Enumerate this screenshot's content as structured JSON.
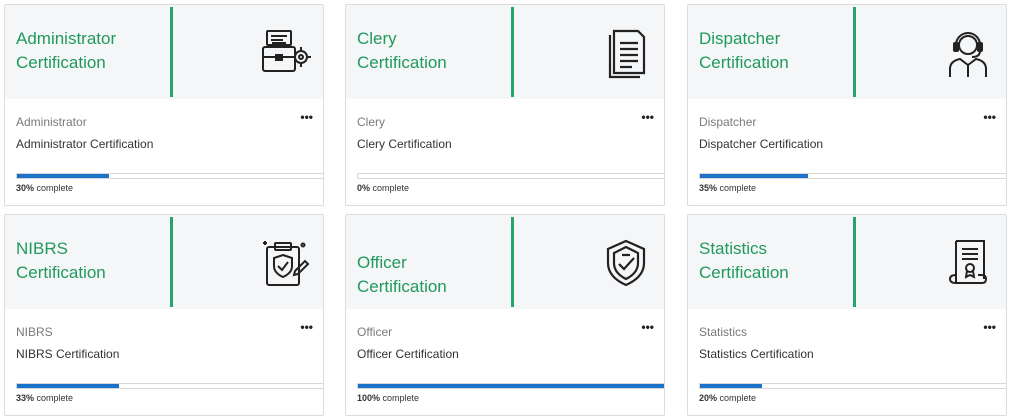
{
  "cards": [
    {
      "title": "Administrator\nCertification",
      "subtitle": "Administrator",
      "description": "Administrator Certification",
      "progress": 30,
      "progress_value": "30%",
      "progress_suffix": " complete",
      "icon": "briefcase-gear-icon",
      "menu": "•••"
    },
    {
      "title": "Clery\nCertification",
      "subtitle": "Clery",
      "description": "Clery Certification",
      "progress": 0,
      "progress_value": "0%",
      "progress_suffix": " complete",
      "icon": "document-icon",
      "menu": "•••"
    },
    {
      "title": "Dispatcher\nCertification",
      "subtitle": "Dispatcher",
      "description": "Dispatcher Certification",
      "progress": 35,
      "progress_value": "35%",
      "progress_suffix": " complete",
      "icon": "headset-operator-icon",
      "menu": "•••"
    },
    {
      "title": "NIBRS\nCertification",
      "subtitle": "NIBRS",
      "description": "NIBRS Certification",
      "progress": 33,
      "progress_value": "33%",
      "progress_suffix": " complete",
      "icon": "clipboard-shield-icon",
      "menu": "•••"
    },
    {
      "title": "Officer\nCertification",
      "subtitle": "Officer",
      "description": "Officer Certification",
      "progress": 100,
      "progress_value": "100%",
      "progress_suffix": " complete",
      "icon": "badge-shield-icon",
      "menu": "•••"
    },
    {
      "title": "Statistics\nCertification",
      "subtitle": "Statistics",
      "description": "Statistics Certification",
      "progress": 20,
      "progress_value": "20%",
      "progress_suffix": " complete",
      "icon": "certificate-scroll-icon",
      "menu": "•••"
    }
  ],
  "colors": {
    "title": "#1f9a5c",
    "accent_bar": "#2aa36a",
    "progress": "#1a73c9",
    "header_bg": "#f5f6f8"
  }
}
